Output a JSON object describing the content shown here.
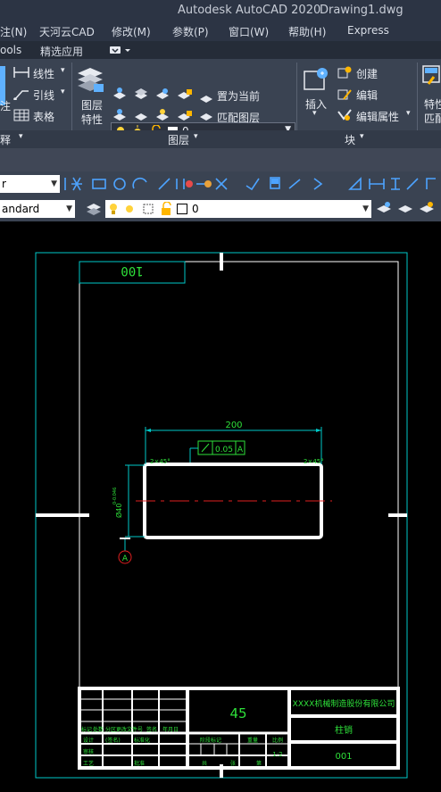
{
  "titlebar": {
    "app": "Autodesk AutoCAD 2020",
    "file": "Drawing1.dwg"
  },
  "menu": [
    "注(N)",
    "天河云CAD",
    "修改(M)",
    "参数(P)",
    "窗口(W)",
    "帮助(H)",
    "Express"
  ],
  "tabs": [
    "ools",
    "精选应用"
  ],
  "ribbon": {
    "annotation": {
      "linear": "线性",
      "leader": "引线",
      "table": "表格",
      "text_partial": "注",
      "footer": "释"
    },
    "layers": {
      "layer_props_line1": "图层",
      "layer_props_line2": "特性",
      "current_layer": "0",
      "set_current": "置为当前",
      "match_layer": "匹配图层",
      "footer": "图层"
    },
    "block": {
      "insert": "插入",
      "create": "创建",
      "edit": "编辑",
      "edit_attributes": "编辑属性",
      "footer": "块"
    },
    "properties": {
      "line1": "特性",
      "line2": "匹配"
    }
  },
  "toolbar1": {
    "style_combo": "r"
  },
  "toolbar2": {
    "dimstyle_combo": "andard",
    "layer_combo": "0"
  },
  "drawing": {
    "top_box_text": "100",
    "dim_width": "200",
    "tolerance_value": "0.05",
    "tolerance_datum": "A",
    "chamfer_left": "2×45°",
    "chamfer_right": "2×45°",
    "diameter_dim": "Ø40",
    "diameter_tolerance": "0-0.046",
    "datum_label": "A",
    "title_center_number": "45",
    "company": "XXXX机械制造股份有限公司",
    "part_name": "柱销",
    "drawing_number": "001",
    "scale": "1:2",
    "tb_labels": [
      "标记",
      "处数",
      "分区",
      "更改文件号",
      "签名",
      "年月日",
      "设计",
      "(签名)",
      "标准化",
      "审核",
      "工艺",
      "批准",
      "阶段标记",
      "重量",
      "比例",
      "共",
      "张",
      "第"
    ]
  }
}
